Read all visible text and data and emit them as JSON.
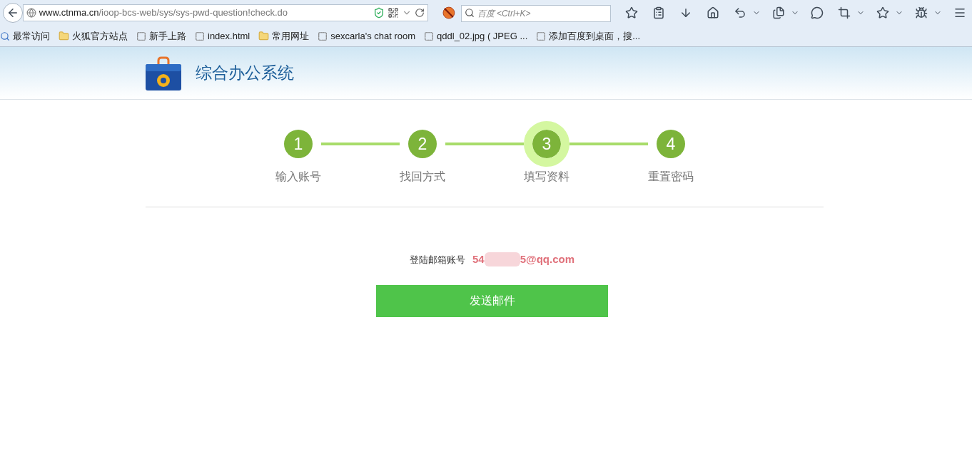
{
  "browser": {
    "url_domain": "www.ctnma.cn",
    "url_path": "/ioop-bcs-web/sys/sys-pwd-question!check.do",
    "search_placeholder": "百度 <Ctrl+K>"
  },
  "bookmarks": [
    {
      "label": "最常访问",
      "kind": "special"
    },
    {
      "label": "火狐官方站点",
      "kind": "folder"
    },
    {
      "label": "新手上路",
      "kind": "page"
    },
    {
      "label": "index.html",
      "kind": "page"
    },
    {
      "label": "常用网址",
      "kind": "folder"
    },
    {
      "label": "sexcarla's chat room",
      "kind": "page"
    },
    {
      "label": "qddl_02.jpg ( JPEG ...",
      "kind": "page"
    },
    {
      "label": "添加百度到桌面，搜...",
      "kind": "page"
    }
  ],
  "header": {
    "title": "综合办公系统"
  },
  "steps": [
    {
      "number": "1",
      "label": "输入账号",
      "selected": false
    },
    {
      "number": "2",
      "label": "找回方式",
      "selected": false
    },
    {
      "number": "3",
      "label": "填写资料",
      "selected": true
    },
    {
      "number": "4",
      "label": "重置密码",
      "selected": false
    }
  ],
  "form": {
    "label": "登陆邮箱账号",
    "email_start": "54",
    "email_end": "5@qq.com",
    "button": "发送邮件"
  }
}
